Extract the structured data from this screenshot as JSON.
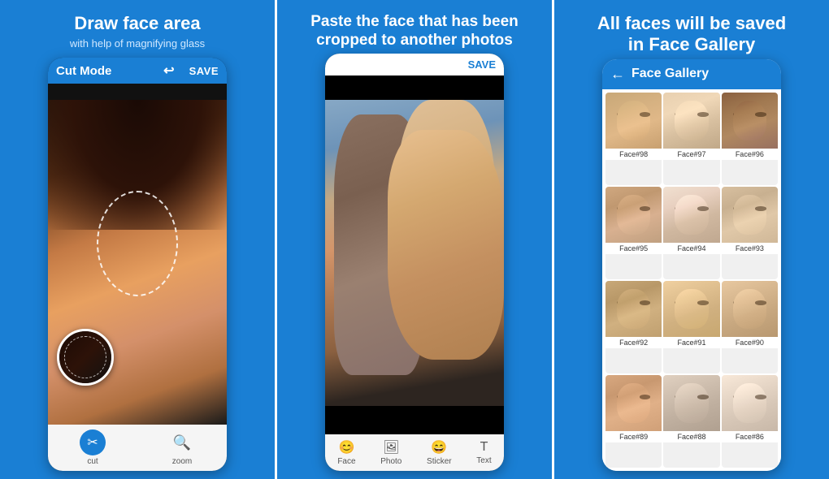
{
  "panel1": {
    "title": "Draw face area",
    "subtitle": "with help of magnifying glass",
    "toolbar": {
      "mode_label": "Cut Mode",
      "save_label": "SAVE"
    },
    "tools": [
      {
        "name": "cut",
        "label": "cut"
      },
      {
        "name": "zoom",
        "label": "zoom"
      }
    ]
  },
  "panel2": {
    "title": "Paste the face that has been cropped to another photos",
    "toolbar": {
      "save_label": "SAVE"
    },
    "tools": [
      {
        "name": "face",
        "label": "Face"
      },
      {
        "name": "photo",
        "label": "Photo"
      },
      {
        "name": "sticker",
        "label": "Sticker"
      },
      {
        "name": "text",
        "label": "Text"
      }
    ]
  },
  "panel3": {
    "title": "All faces will be saved in Face Gallery",
    "gallery_header": "Face Gallery",
    "faces": [
      {
        "id": "face-98",
        "label": "Face#98",
        "css_class": "face-98"
      },
      {
        "id": "face-97",
        "label": "Face#97",
        "css_class": "face-97"
      },
      {
        "id": "face-96",
        "label": "Face#96",
        "css_class": "face-96"
      },
      {
        "id": "face-95",
        "label": "Face#95",
        "css_class": "face-95"
      },
      {
        "id": "face-94",
        "label": "Face#94",
        "css_class": "face-94"
      },
      {
        "id": "face-93",
        "label": "Face#93",
        "css_class": "face-93"
      },
      {
        "id": "face-92",
        "label": "Face#92",
        "css_class": "face-92"
      },
      {
        "id": "face-91",
        "label": "Face#91",
        "css_class": "face-91"
      },
      {
        "id": "face-90",
        "label": "Face#90",
        "css_class": "face-90"
      },
      {
        "id": "face-89",
        "label": "Face#89",
        "css_class": "face-89"
      },
      {
        "id": "face-88",
        "label": "Face#88",
        "css_class": "face-88"
      },
      {
        "id": "face-86",
        "label": "Face#86",
        "css_class": "face-86"
      }
    ]
  },
  "colors": {
    "blue": "#1a7fd4",
    "white": "#ffffff",
    "dark": "#1a1a1a"
  }
}
